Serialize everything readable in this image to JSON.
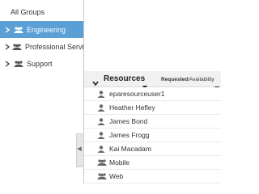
{
  "groups_panel": {
    "all_groups_label": "All Groups",
    "groups": [
      {
        "label": "Engineering",
        "selected": true
      },
      {
        "label": "Professional Services",
        "selected": false
      },
      {
        "label": "Support",
        "selected": false
      }
    ]
  },
  "resources_panel": {
    "title": "Resources",
    "requested_label": "Requested",
    "availability_label": "/Availability",
    "items": [
      {
        "label": "eparesourceuser1",
        "icon": "user-icon"
      },
      {
        "label": "Heather Hefley",
        "icon": "user-icon"
      },
      {
        "label": "James Bond",
        "icon": "user-icon"
      },
      {
        "label": "James Frogg",
        "icon": "user-icon"
      },
      {
        "label": "Kai Macadam",
        "icon": "user-icon"
      },
      {
        "label": "Mobile",
        "icon": "group-icon"
      },
      {
        "label": "Web",
        "icon": "group-icon"
      }
    ]
  },
  "colors": {
    "selected_row": "#5a9fd6",
    "header_bg": "#f1f1f1"
  }
}
